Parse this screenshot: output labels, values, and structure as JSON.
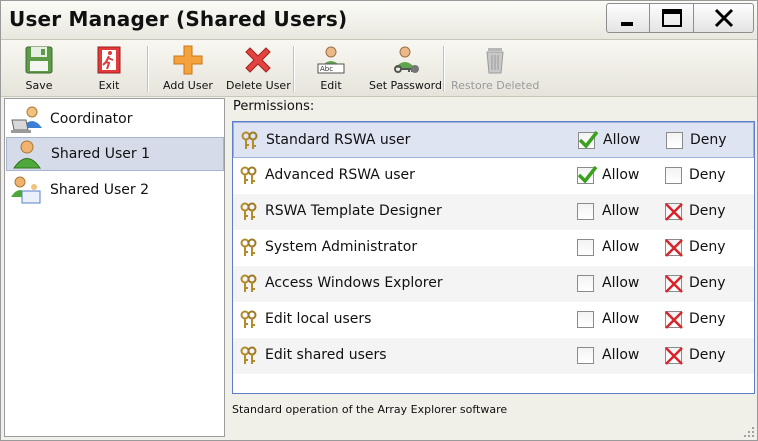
{
  "window": {
    "title": "User Manager (Shared Users)"
  },
  "toolbar": {
    "save": "Save",
    "exit": "Exit",
    "add_user": "Add User",
    "delete_user": "Delete User",
    "edit": "Edit",
    "set_password": "Set Password",
    "restore_deleted": "Restore Deleted"
  },
  "users": [
    {
      "label": "Coordinator",
      "icon": "coordinator-user-icon",
      "selected": false
    },
    {
      "label": "Shared User 1",
      "icon": "user-icon",
      "selected": true
    },
    {
      "label": "Shared User 2",
      "icon": "user-group-icon",
      "selected": false
    }
  ],
  "permissions": {
    "header": "Permissions:",
    "allow_label": "Allow",
    "deny_label": "Deny",
    "rows": [
      {
        "name": "Standard RSWA user",
        "allow": true,
        "deny": false
      },
      {
        "name": "Advanced RSWA user",
        "allow": true,
        "deny": false
      },
      {
        "name": "RSWA Template Designer",
        "allow": false,
        "deny": true
      },
      {
        "name": "System Administrator",
        "allow": false,
        "deny": true
      },
      {
        "name": "Access Windows Explorer",
        "allow": false,
        "deny": true
      },
      {
        "name": "Edit local users",
        "allow": false,
        "deny": true
      },
      {
        "name": "Edit shared users",
        "allow": false,
        "deny": true
      }
    ]
  },
  "status": {
    "description": "Standard operation of the Array Explorer software"
  },
  "colors": {
    "allow_check": "#3aa11e",
    "deny_x": "#d8262a",
    "selection": "#dfe4f3",
    "list_border": "#5b7fc8"
  }
}
